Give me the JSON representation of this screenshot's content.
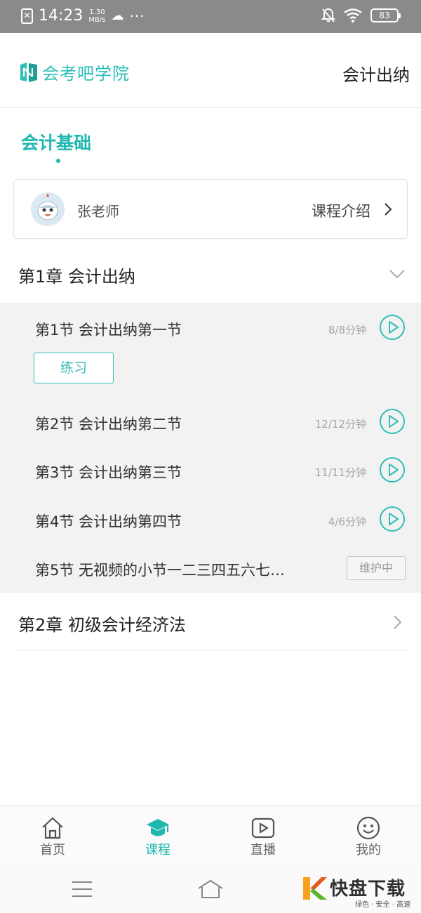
{
  "status_bar": {
    "time": "14:23",
    "speed_value": "1.30",
    "speed_unit": "MB/s",
    "battery": "83",
    "icons": [
      "sim-icon",
      "cloud-icon",
      "more-dots-icon",
      "mute-bell-icon",
      "wifi-icon",
      "battery-icon"
    ]
  },
  "header": {
    "logo_text": "会考吧学院",
    "title": "会计出纳"
  },
  "subject_tab": {
    "label": "会计基础",
    "accent_color": "#1fb7b0"
  },
  "teacher_card": {
    "name": "张老师",
    "intro_label": "课程介绍"
  },
  "chapters": [
    {
      "title": "第1章  会计出纳",
      "expanded": true,
      "lessons": [
        {
          "title": "第1节  会计出纳第一节",
          "duration": "8/8分钟",
          "action": "play"
        },
        {
          "title": "第2节  会计出纳第二节",
          "duration": "12/12分钟",
          "action": "play"
        },
        {
          "title": "第3节  会计出纳第三节",
          "duration": "11/11分钟",
          "action": "play"
        },
        {
          "title": "第4节  会计出纳第四节",
          "duration": "4/6分钟",
          "action": "play"
        },
        {
          "title": "第5节  无视频的小节一二三四五六七…",
          "duration": "",
          "action": "维护中"
        }
      ],
      "practice_label": "练习"
    },
    {
      "title": "第2章  初级会计经济法",
      "expanded": false
    }
  ],
  "bottom_nav": {
    "items": [
      {
        "label": "首页",
        "icon": "home-icon",
        "active": false
      },
      {
        "label": "课程",
        "icon": "graduation-cap-icon",
        "active": true
      },
      {
        "label": "直播",
        "icon": "live-play-icon",
        "active": false
      },
      {
        "label": "我的",
        "icon": "smiley-icon",
        "active": false
      }
    ]
  },
  "watermark": {
    "brand": "快盘下载",
    "tagline": "绿色 · 安全 · 高速"
  }
}
